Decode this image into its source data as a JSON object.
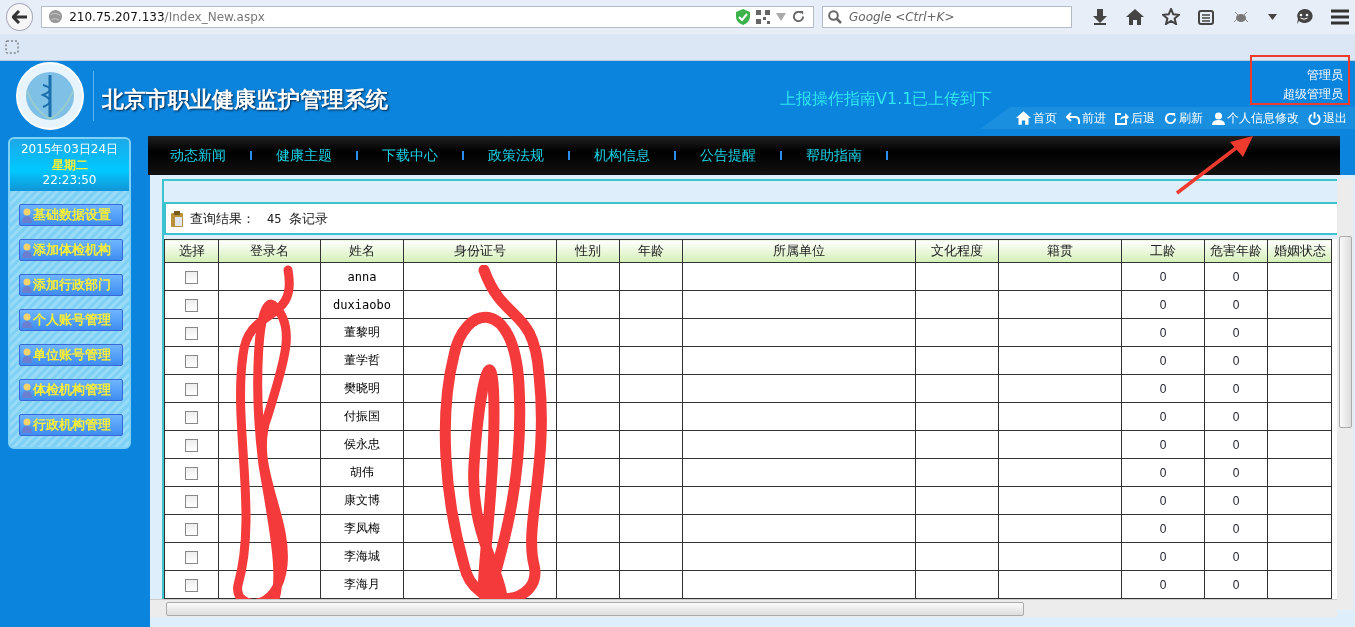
{
  "browser": {
    "url_host": "210.75.207.133",
    "url_path": "/Index_New.aspx",
    "search_placeholder": "Google <Ctrl+K>"
  },
  "header": {
    "title": "北京市职业健康监护管理系统",
    "notice": "上报操作指南V1.1已上传到下",
    "user_role": "管理员",
    "user_level": "超级管理员",
    "toolbar": [
      "首页",
      "前进",
      "后退",
      "刷新",
      "个人信息修改",
      "退出"
    ]
  },
  "sidebar": {
    "date": "2015年03日24日",
    "weekday": "星期二",
    "time": "22:23:50",
    "items": [
      "基础数据设置",
      "添加体检机构",
      "添加行政部门",
      "个人账号管理",
      "单位账号管理",
      "体检机构管理",
      "行政机构管理"
    ]
  },
  "nav": [
    "动态新闻",
    "健康主题",
    "下载中心",
    "政策法规",
    "机构信息",
    "公告提醒",
    "帮助指南"
  ],
  "result": {
    "label": "查询结果：",
    "count": "45",
    "unit": "条记录"
  },
  "table": {
    "columns": [
      "选择",
      "登录名",
      "姓名",
      "身份证号",
      "性别",
      "年龄",
      "所属单位",
      "文化程度",
      "籍贯",
      "工龄",
      "危害年龄",
      "婚姻状态"
    ],
    "rows": [
      {
        "checked": false,
        "name": "anna",
        "seniority": "0",
        "hazard_years": "0"
      },
      {
        "checked": false,
        "name": "duxiaobo",
        "seniority": "0",
        "hazard_years": "0"
      },
      {
        "checked": false,
        "name": "董黎明",
        "seniority": "0",
        "hazard_years": "0"
      },
      {
        "checked": false,
        "name": "董学哲",
        "seniority": "0",
        "hazard_years": "0"
      },
      {
        "checked": false,
        "name": "樊晓明",
        "seniority": "0",
        "hazard_years": "0"
      },
      {
        "checked": false,
        "name": "付振国",
        "seniority": "0",
        "hazard_years": "0"
      },
      {
        "checked": false,
        "name": "侯永忠",
        "seniority": "0",
        "hazard_years": "0"
      },
      {
        "checked": false,
        "name": "胡伟",
        "seniority": "0",
        "hazard_years": "0"
      },
      {
        "checked": false,
        "name": "康文博",
        "seniority": "0",
        "hazard_years": "0"
      },
      {
        "checked": false,
        "name": "李凤梅",
        "seniority": "0",
        "hazard_years": "0"
      },
      {
        "checked": false,
        "name": "李海城",
        "seniority": "0",
        "hazard_years": "0"
      },
      {
        "checked": false,
        "name": "李海月",
        "seniority": "0",
        "hazard_years": "0"
      }
    ]
  }
}
